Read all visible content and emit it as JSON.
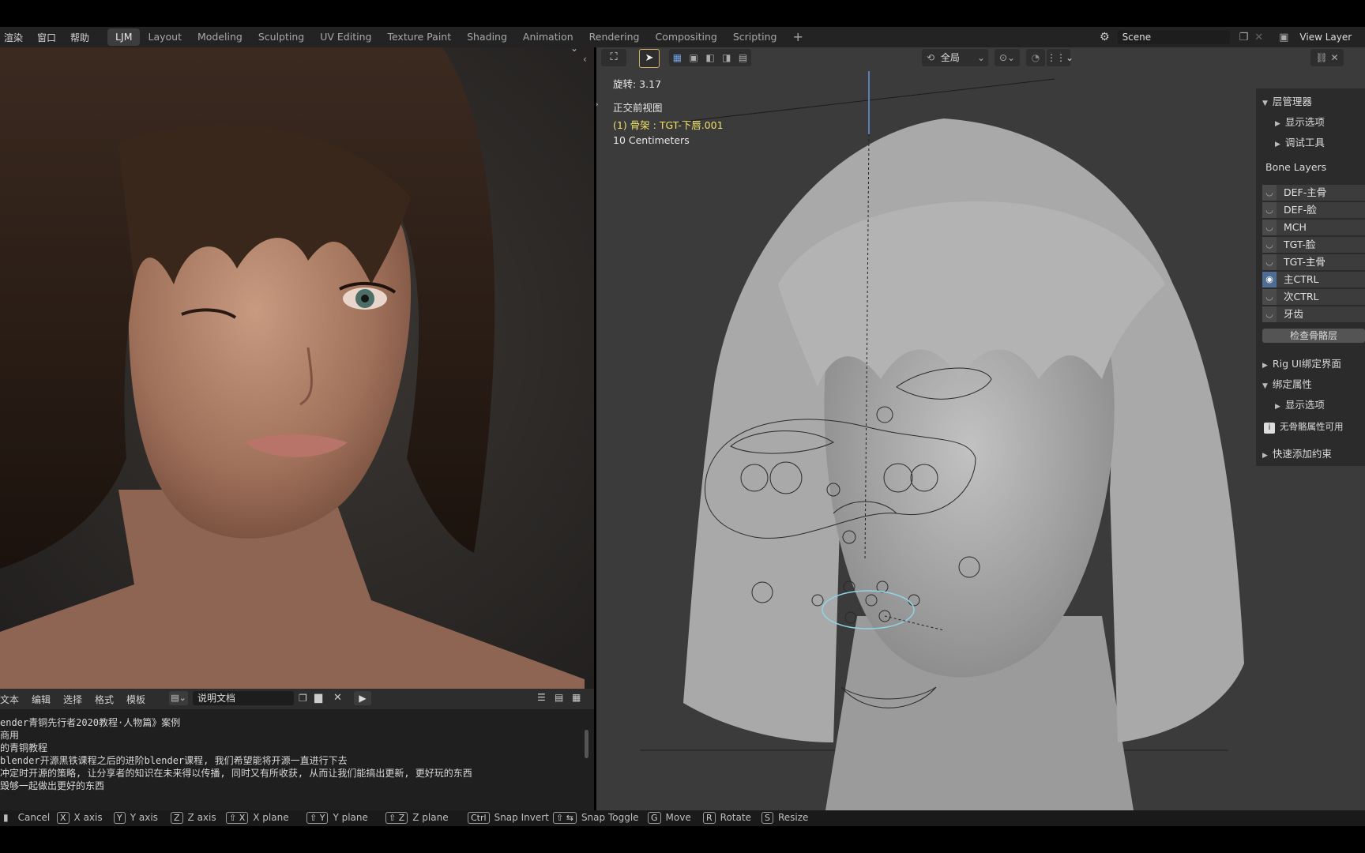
{
  "menu": [
    "渲染",
    "窗口",
    "帮助"
  ],
  "workspace_tabs": [
    "LJM",
    "Layout",
    "Modeling",
    "Sculpting",
    "UV Editing",
    "Texture Paint",
    "Shading",
    "Animation",
    "Rendering",
    "Compositing",
    "Scripting"
  ],
  "active_tab": "LJM",
  "scene": {
    "name": "Scene",
    "view_layer": "View Layer"
  },
  "viewport": {
    "transform_orientation": "全局",
    "rotation_readout": "旋转: 3.17",
    "view_name": "正交前视图",
    "active_object": "(1) 骨架 : TGT-下唇.001",
    "grid_scale": "10 Centimeters"
  },
  "n_panel": {
    "layer_manager": "层管理器",
    "display_options": "显示选项",
    "debug_tools": "调试工具",
    "bone_layers_label": "Bone Layers",
    "bone_layers": [
      {
        "name": "DEF-主骨",
        "visible": false
      },
      {
        "name": "DEF-脸",
        "visible": false
      },
      {
        "name": "MCH",
        "visible": false
      },
      {
        "name": "TGT-脸",
        "visible": false
      },
      {
        "name": "TGT-主骨",
        "visible": false
      },
      {
        "name": "主CTRL",
        "visible": true
      },
      {
        "name": "次CTRL",
        "visible": false
      },
      {
        "name": "牙齿",
        "visible": false
      }
    ],
    "check_layers_button": "检查骨骼层",
    "rig_ui": "Rig UI绑定界面",
    "rig_properties": "绑定属性",
    "display_options_2": "显示选项",
    "no_properties": "无骨骼属性可用",
    "quick_constraints": "快速添加约束"
  },
  "text_editor": {
    "menu": [
      "文本",
      "编辑",
      "选择",
      "格式",
      "模板"
    ],
    "document_name": "说明文档",
    "lines": [
      "ender青铜先行者2020教程·人物篇》案例",
      "商用",
      "的青铜教程",
      "blender开源黑铁课程之后的进阶blender课程, 我们希望能将开源一直进行下去",
      "冲定时开源的策略, 让分享者的知识在未来得以传播, 同时又有所收获, 从而让我们能搞出更新, 更好玩的东西",
      "毁够一起做出更好的东西"
    ]
  },
  "statusbar": [
    {
      "key": "",
      "label": "Cancel"
    },
    {
      "key": "X",
      "label": "X axis"
    },
    {
      "key": "Y",
      "label": "Y axis"
    },
    {
      "key": "Z",
      "label": "Z axis"
    },
    {
      "key": "⇧ X",
      "label": "X plane"
    },
    {
      "key": "⇧ Y",
      "label": "Y plane"
    },
    {
      "key": "⇧ Z",
      "label": "Z plane"
    },
    {
      "key": "Ctrl",
      "label": "Snap Invert"
    },
    {
      "key": "⇧ ⇆",
      "label": "Snap Toggle"
    },
    {
      "key": "G",
      "label": "Move"
    },
    {
      "key": "R",
      "label": "Rotate"
    },
    {
      "key": "S",
      "label": "Resize"
    }
  ],
  "colors": {
    "accent": "#4772b3",
    "active_object": "#f0e06a",
    "active_layer": "#4f6d93"
  }
}
